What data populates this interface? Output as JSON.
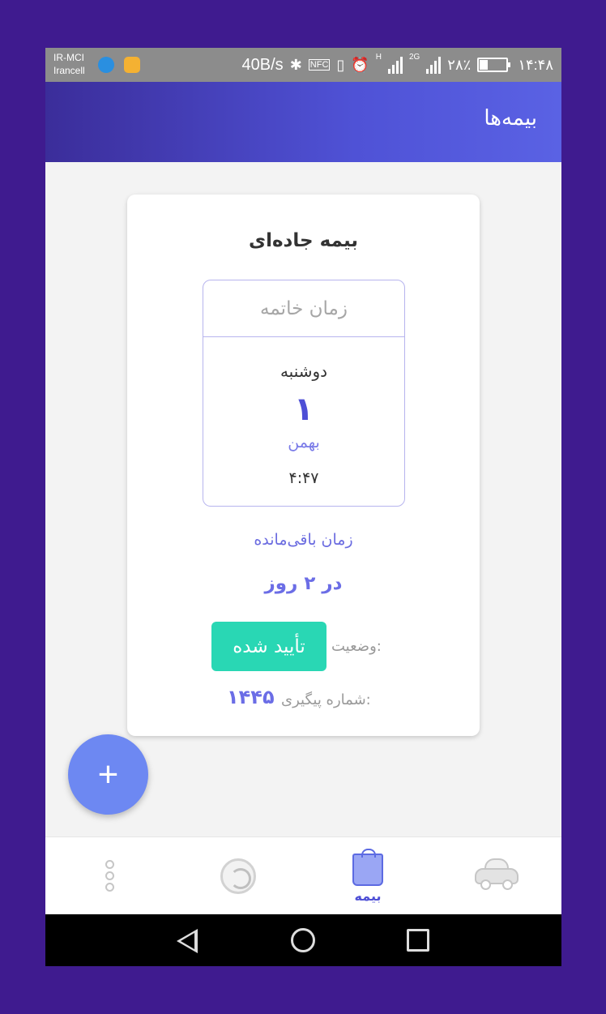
{
  "status_bar": {
    "carrier_1": "IR-MCI",
    "carrier_2": "Irancell",
    "net_speed": "40B/s",
    "nfc": "NFC",
    "network_type_1": "H",
    "network_type_2": "2G",
    "battery": "۲۸٪",
    "time": "۱۴:۴۸"
  },
  "app_bar": {
    "title": "بیمه‌ها"
  },
  "card": {
    "title": "بیمه جاده‌ای",
    "expiry": {
      "header": "زمان خاتمه",
      "weekday": "دوشنبه",
      "day": "۱",
      "month": "بهمن",
      "time": "۴:۴۷"
    },
    "remaining_label": "زمان باقی‌مانده",
    "remaining_value": "در ۲ روز",
    "status_label": "وضعیت:",
    "status_value": "تأیید شده",
    "tracking_label": "شماره پیگیری:",
    "tracking_value": "۱۴۴۵"
  },
  "fab": {
    "icon": "plus-icon",
    "label": "+"
  },
  "bottom_nav": {
    "items": [
      {
        "icon": "more-icon",
        "label": ""
      },
      {
        "icon": "history-icon",
        "label": ""
      },
      {
        "icon": "insurance-bag-icon",
        "label": "بیمه",
        "active": true
      },
      {
        "icon": "car-icon",
        "label": ""
      }
    ],
    "active_color": "#4e4fd6"
  },
  "colors": {
    "background": "#3f1b8f",
    "accent": "#4e4fd6",
    "status_badge": "#29d7b4",
    "fab": "#6d88f2"
  }
}
